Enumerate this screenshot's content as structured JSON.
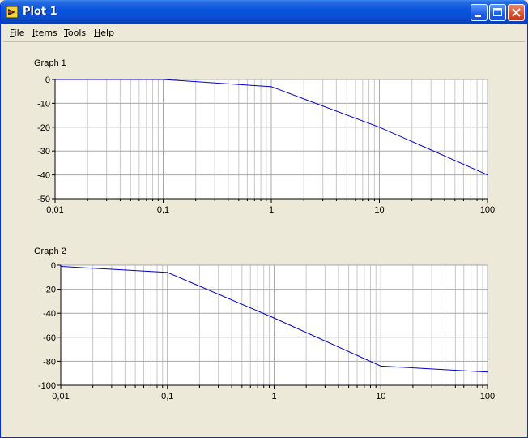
{
  "window": {
    "title": "Plot 1",
    "accent": "#0855DD"
  },
  "menu": [
    {
      "label": "File",
      "accel": "F",
      "rest": "ile"
    },
    {
      "label": "Items",
      "accel": "I",
      "rest": "tems"
    },
    {
      "label": "Tools",
      "accel": "T",
      "rest": "ools"
    },
    {
      "label": "Help",
      "accel": "H",
      "rest": "elp"
    }
  ],
  "graphs": [
    {
      "name": "Graph 1",
      "x_ticks": [
        "0,01",
        "0,1",
        "1",
        "10",
        "100"
      ],
      "y_ticks": [
        "0",
        "-10",
        "-20",
        "-30",
        "-40",
        "-50"
      ]
    },
    {
      "name": "Graph 2",
      "x_ticks": [
        "0,01",
        "0,1",
        "1",
        "10",
        "100"
      ],
      "y_ticks": [
        "0",
        "-20",
        "-40",
        "-60",
        "-80",
        "-100"
      ]
    }
  ],
  "chart_data": [
    {
      "type": "line",
      "title": "Graph 1",
      "x_scale": "log",
      "xlim": [
        0.01,
        100
      ],
      "ylim": [
        -50,
        0
      ],
      "grid": true,
      "line_color": "#0000CC",
      "series": [
        {
          "x": [
            0.01,
            0.1,
            1,
            10,
            100
          ],
          "y": [
            0,
            0,
            -3,
            -20,
            -40
          ]
        }
      ]
    },
    {
      "type": "line",
      "title": "Graph 2",
      "x_scale": "log",
      "xlim": [
        0.01,
        100
      ],
      "ylim": [
        -100,
        0
      ],
      "grid": true,
      "line_color": "#0000CC",
      "series": [
        {
          "x": [
            0.01,
            0.1,
            1,
            10,
            100
          ],
          "y": [
            -1,
            -6,
            -44,
            -84,
            -89
          ]
        }
      ]
    }
  ]
}
